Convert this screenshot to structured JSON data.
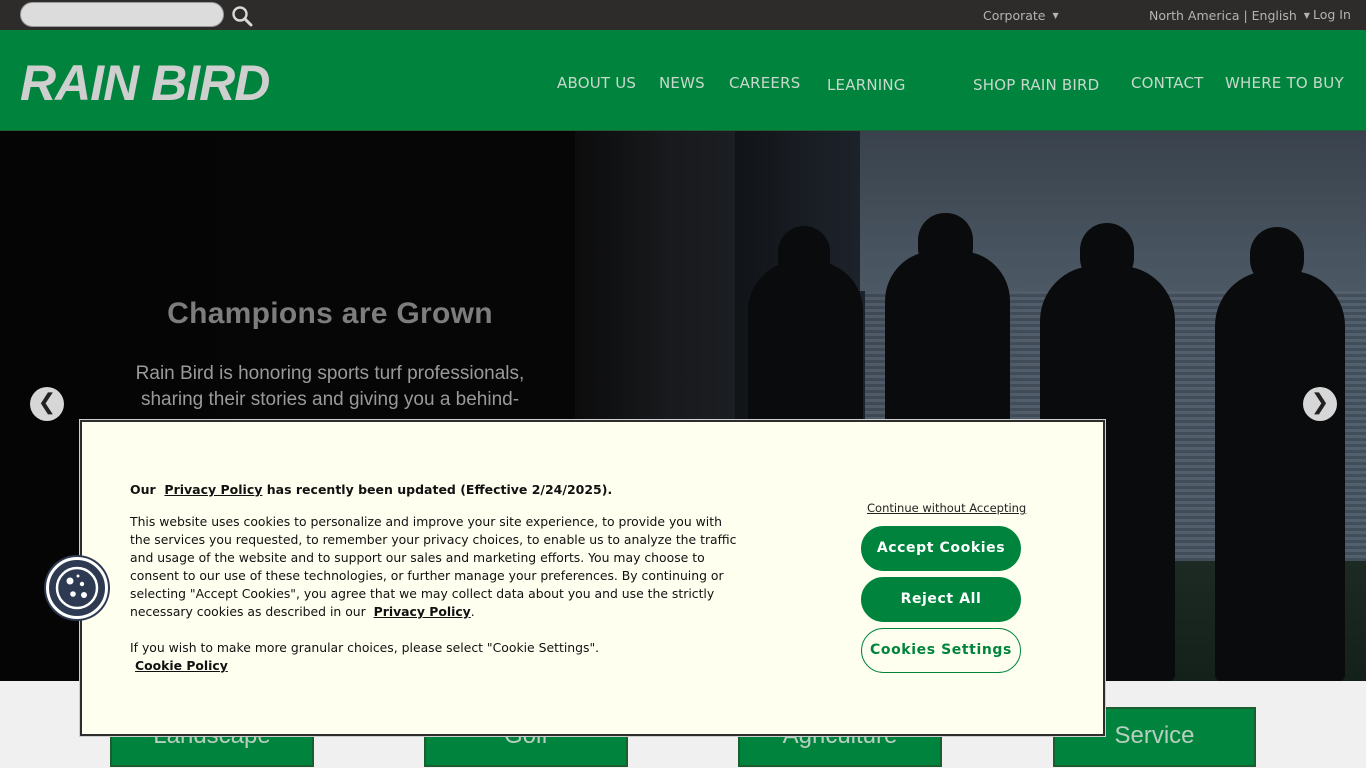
{
  "topbar": {
    "search": {
      "value": "",
      "placeholder": ""
    },
    "corporate_label": "Corporate",
    "region_label": "North America | English",
    "login_label": "Log In"
  },
  "header": {
    "logo_text": "RAIN BIRD",
    "nav": [
      {
        "label": "ABOUT US"
      },
      {
        "label": "NEWS"
      },
      {
        "label": "CAREERS"
      },
      {
        "label": "LEARNING"
      },
      {
        "label": "SHOP RAIN BIRD"
      },
      {
        "label": "CONTACT"
      },
      {
        "label": "WHERE TO BUY"
      }
    ]
  },
  "hero": {
    "title": "Champions are Grown",
    "text": "Rain Bird is honoring sports turf professionals, sharing their stories and giving you a behind-"
  },
  "tiles": [
    {
      "label": "Landscape"
    },
    {
      "label": "Golf"
    },
    {
      "label": "Agriculture"
    },
    {
      "label": "Service"
    }
  ],
  "cookie": {
    "heading_prefix": "Our",
    "heading_link": "Privacy Policy",
    "heading_suffix": "has recently been updated (Effective 2/24/2025).",
    "body": "This website uses cookies to personalize and improve your site experience, to provide you with the services you requested, to remember your privacy choices, to enable us to analyze the traffic and usage of the website and to support our sales and marketing efforts. You may choose to consent to our use of these technologies, or further manage your preferences. By continuing or selecting \"Accept Cookies\", you agree that we may collect data about you and use the strictly necessary cookies as described in our",
    "body_link": "Privacy Policy",
    "body2": "If you wish to make more granular choices, please select \"Cookie Settings\".",
    "cookie_policy_link": "Cookie Policy",
    "continue_label": "Continue without Accepting",
    "accept_label": "Accept Cookies",
    "reject_label": "Reject All",
    "settings_label": "Cookies Settings"
  },
  "colors": {
    "brand_green": "#00843d",
    "topbar": "#2d2c2a",
    "banner_bg": "#fffff0"
  }
}
